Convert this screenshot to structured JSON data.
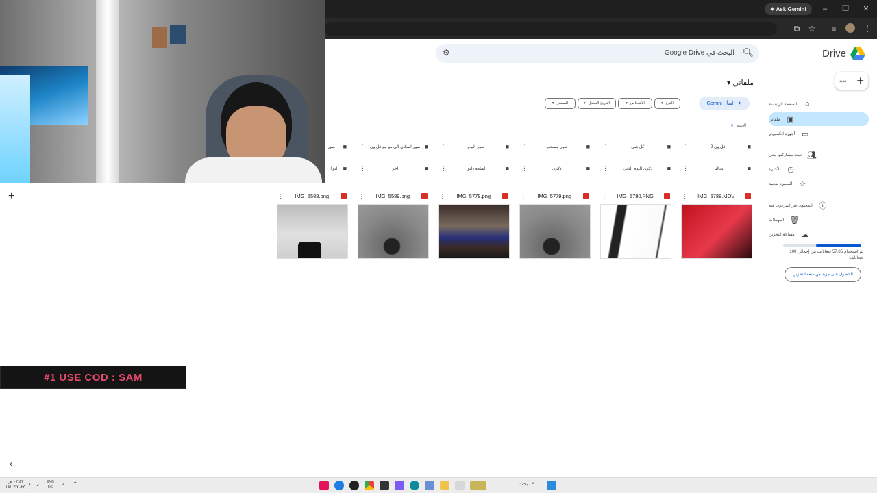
{
  "browser": {
    "ask_gemini": "Ask Gemini",
    "window_controls": [
      "–",
      "❐",
      "✕"
    ]
  },
  "drive": {
    "logo_text": "Drive",
    "search_placeholder": "البحث في Google Drive",
    "new_button": "جديد",
    "page_title": "ملفاتي",
    "nav": [
      {
        "label": "الصفحة الرئيسية",
        "icon": "home-icon"
      },
      {
        "label": "ملفاتي",
        "icon": "my-drive-icon",
        "active": true
      },
      {
        "label": "أجهزة الكمبيوتر",
        "icon": "computer-icon"
      },
      {
        "label": "تمت مشاركتها معي",
        "icon": "shared-icon"
      },
      {
        "label": "الأخيرة",
        "icon": "clock-icon"
      },
      {
        "label": "المميزة بنجمة",
        "icon": "star-icon"
      },
      {
        "label": "المحتوى غير المرغوب فيه",
        "icon": "spam-icon"
      },
      {
        "label": "المهملات",
        "icon": "trash-icon"
      },
      {
        "label": "مساحة التخزين",
        "icon": "cloud-icon"
      }
    ],
    "storage_text": "تم استخدام 57.85 غيغابايت من إجمالي 100 غيغابايت",
    "storage_fraction": 0.58,
    "storage_button": "الحصول على مزيد من سعة التخزين",
    "gemini_chip": "اسأل Gemini",
    "filters": [
      "النوع",
      "الأشخاص",
      "التاريخ المعدل",
      "المصدر"
    ],
    "sort_label": "الاسم",
    "folders_row1": [
      "قل ون 2",
      "كل شي",
      "صور مسحب",
      "صور اليوم",
      "صور المكان الي مو مع قل ون",
      "صور"
    ],
    "folders_row2": [
      "تحاليل",
      "ذكرى اليوم الثاني",
      "ذكرى",
      "اسامه دانق",
      "اخر",
      "ابو ال"
    ],
    "files": [
      {
        "name": "IMG_5788.MOV",
        "type": "video"
      },
      {
        "name": "IMG_5780.PNG",
        "type": "image"
      },
      {
        "name": "IMG_5779.png",
        "type": "image"
      },
      {
        "name": "IMG_5778.png",
        "type": "image"
      },
      {
        "name": "IMG_5589.png",
        "type": "image"
      },
      {
        "name": "IMG_5588.png",
        "type": "image"
      }
    ]
  },
  "overlay": {
    "promo_text": "#1 USE COD : SAM"
  },
  "taskbar": {
    "lang_top": "ENG",
    "lang_bottom": "US",
    "time": "٠٣:٤٣ ص",
    "date": "١٨/٠٣/٢٠٢٥",
    "search_label": "بحث"
  },
  "colors": {
    "accent": "#0b57d0",
    "active_nav": "#c2e7ff",
    "promo_text": "#e24b6c"
  }
}
